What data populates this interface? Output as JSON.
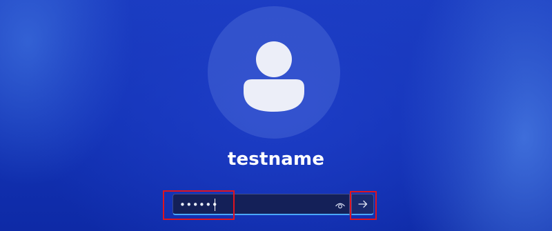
{
  "user": {
    "name": "testname",
    "avatar_icon": "user-silhouette-icon"
  },
  "password_field": {
    "value": "••••••",
    "reveal_icon": "eye-icon"
  },
  "submit": {
    "icon": "arrow-right-icon"
  },
  "colors": {
    "background": "#1232b4",
    "field_background": "#142058",
    "focus_accent": "#4aa8ff",
    "highlight_box": "#e0141e"
  }
}
